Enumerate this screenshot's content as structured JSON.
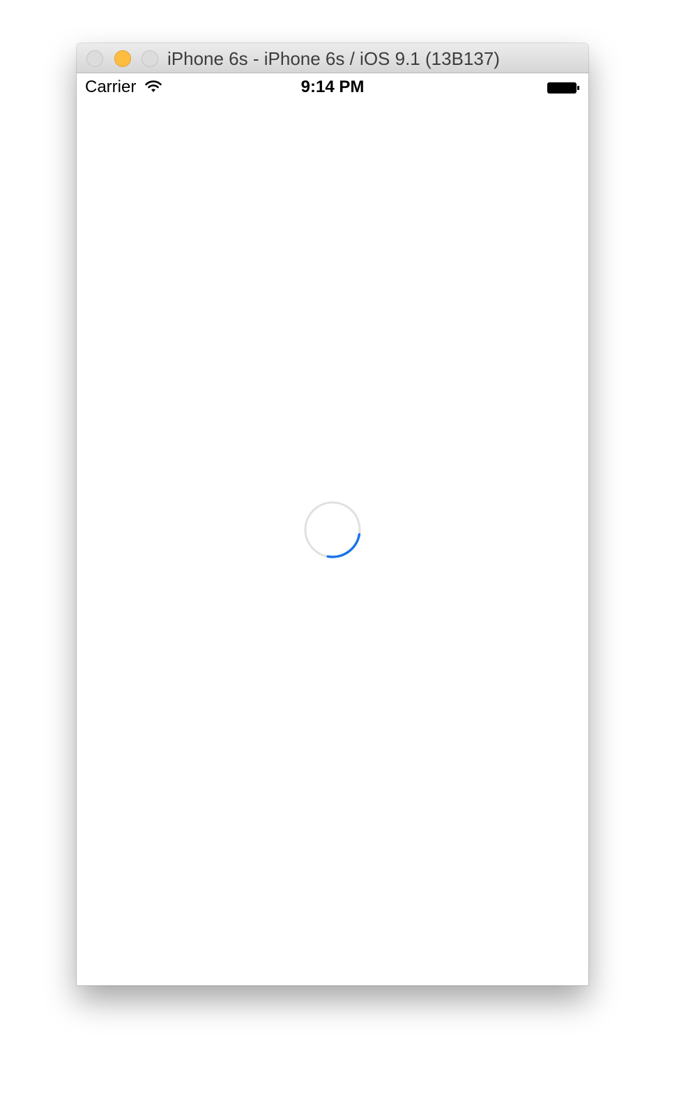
{
  "window": {
    "title": "iPhone 6s - iPhone 6s / iOS 9.1 (13B137)",
    "controls": [
      "close-icon",
      "minimize-icon",
      "zoom-icon"
    ]
  },
  "status_bar": {
    "carrier": "Carrier",
    "time": "9:14 PM",
    "icons": [
      "wifi-icon",
      "battery-icon"
    ]
  },
  "content": {
    "loading_indicator": "spinner-icon"
  },
  "colors": {
    "accent": "#1a73e8",
    "spinner_track": "#e0e0e0",
    "minimize_button": "#fdbd41"
  }
}
